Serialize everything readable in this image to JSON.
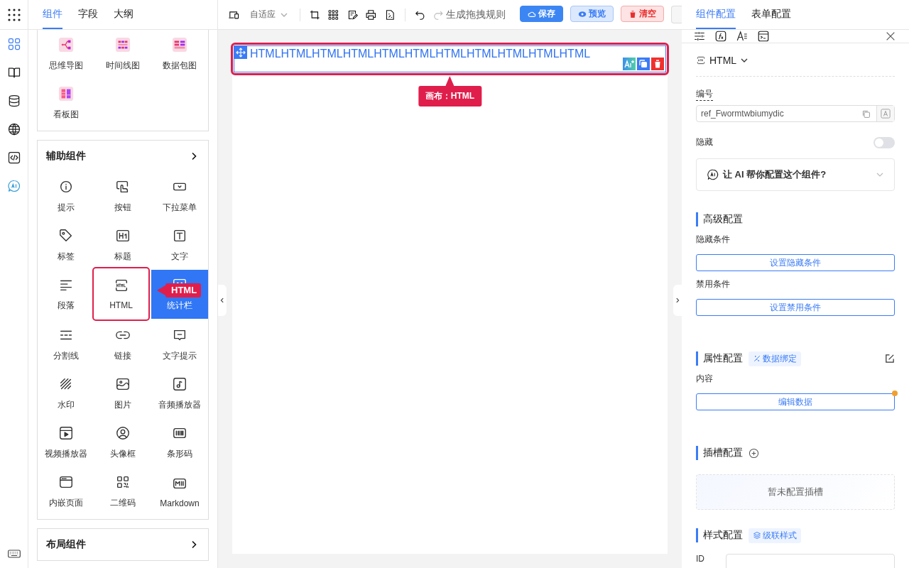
{
  "rail": {
    "items": [
      {
        "selected": true
      },
      {
        "selected": false
      },
      {
        "selected": false
      },
      {
        "selected": false
      },
      {
        "selected": false
      },
      {
        "selected": false
      }
    ]
  },
  "left_panel": {
    "tabs": [
      {
        "label": "组件",
        "selected": true
      },
      {
        "label": "字段",
        "selected": false
      },
      {
        "label": "大纲",
        "selected": false
      }
    ],
    "groups": [
      {
        "items": [
          {
            "label": "思维导图",
            "selected": false,
            "hovered": false
          },
          {
            "label": "时间线图",
            "selected": false,
            "hovered": false
          },
          {
            "label": "数据包图",
            "selected": false,
            "hovered": false
          },
          {
            "label": "看板图",
            "selected": false,
            "hovered": false
          }
        ]
      },
      {
        "title": "辅助组件",
        "items": [
          {
            "label": "提示",
            "selected": false,
            "hovered": false
          },
          {
            "label": "按钮",
            "selected": false,
            "hovered": false
          },
          {
            "label": "下拉菜单",
            "selected": false,
            "hovered": false
          },
          {
            "label": "标签",
            "selected": false,
            "hovered": false
          },
          {
            "label": "标题",
            "selected": false,
            "hovered": false
          },
          {
            "label": "文字",
            "selected": false,
            "hovered": false
          },
          {
            "label": "段落",
            "selected": false,
            "hovered": false
          },
          {
            "label": "HTML",
            "selected": true,
            "hovered": false
          },
          {
            "label": "统计栏",
            "selected": false,
            "hovered": true
          },
          {
            "label": "分割线",
            "selected": false,
            "hovered": false
          },
          {
            "label": "链接",
            "selected": false,
            "hovered": false
          },
          {
            "label": "文字提示",
            "selected": false,
            "hovered": false
          },
          {
            "label": "水印",
            "selected": false,
            "hovered": false
          },
          {
            "label": "图片",
            "selected": false,
            "hovered": false
          },
          {
            "label": "音频播放器",
            "selected": false,
            "hovered": false
          },
          {
            "label": "视频播放器",
            "selected": false,
            "hovered": false
          },
          {
            "label": "头像框",
            "selected": false,
            "hovered": false
          },
          {
            "label": "条形码",
            "selected": false,
            "hovered": false
          },
          {
            "label": "内嵌页面",
            "selected": false,
            "hovered": false
          },
          {
            "label": "二维码",
            "selected": false,
            "hovered": false
          },
          {
            "label": "Markdown",
            "selected": false,
            "hovered": false
          }
        ]
      },
      {
        "title": "布局组件"
      }
    ],
    "hover_tip": "HTML"
  },
  "toolbar": {
    "screen_mode": "自适应",
    "rule_text": "生成拖拽规则",
    "buttons": [
      {
        "label": "保存",
        "kind": "primary"
      },
      {
        "label": "预览",
        "kind": "info"
      },
      {
        "label": "清空",
        "kind": "danger"
      }
    ]
  },
  "canvas": {
    "element": {
      "text": "HTMLHTMLHTMLHTMLHTMLHTMLHTMLHTMLHTMLHTMLHTML",
      "selected": true
    },
    "tip": "画布：HTML"
  },
  "right_panel": {
    "tabs": [
      {
        "label": "组件配置",
        "selected": true
      },
      {
        "label": "表单配置",
        "selected": false
      }
    ],
    "component": "HTML",
    "id_field": {
      "label": "编号",
      "value": "ref_Fwormtwbiumydic"
    },
    "hidden": {
      "label": "隐藏",
      "on": false
    },
    "ai_prompt": "让 AI 帮你配置这个组件?",
    "sections": [
      {
        "kind": "advanced",
        "title": "高级配置",
        "fields": [
          {
            "label": "隐藏条件",
            "button": "设置隐藏条件",
            "changed": false
          },
          {
            "label": "禁用条件",
            "button": "设置禁用条件",
            "changed": false
          }
        ]
      },
      {
        "kind": "props",
        "title": "属性配置",
        "tag": "数据绑定",
        "fields": [
          {
            "label": "内容",
            "button": "编辑数据",
            "changed": true
          }
        ]
      },
      {
        "kind": "slots",
        "title": "插槽配置",
        "empty": "暂未配置插槽"
      },
      {
        "kind": "style",
        "title": "样式配置",
        "tag": "级联样式",
        "input_label": "ID"
      }
    ]
  }
}
